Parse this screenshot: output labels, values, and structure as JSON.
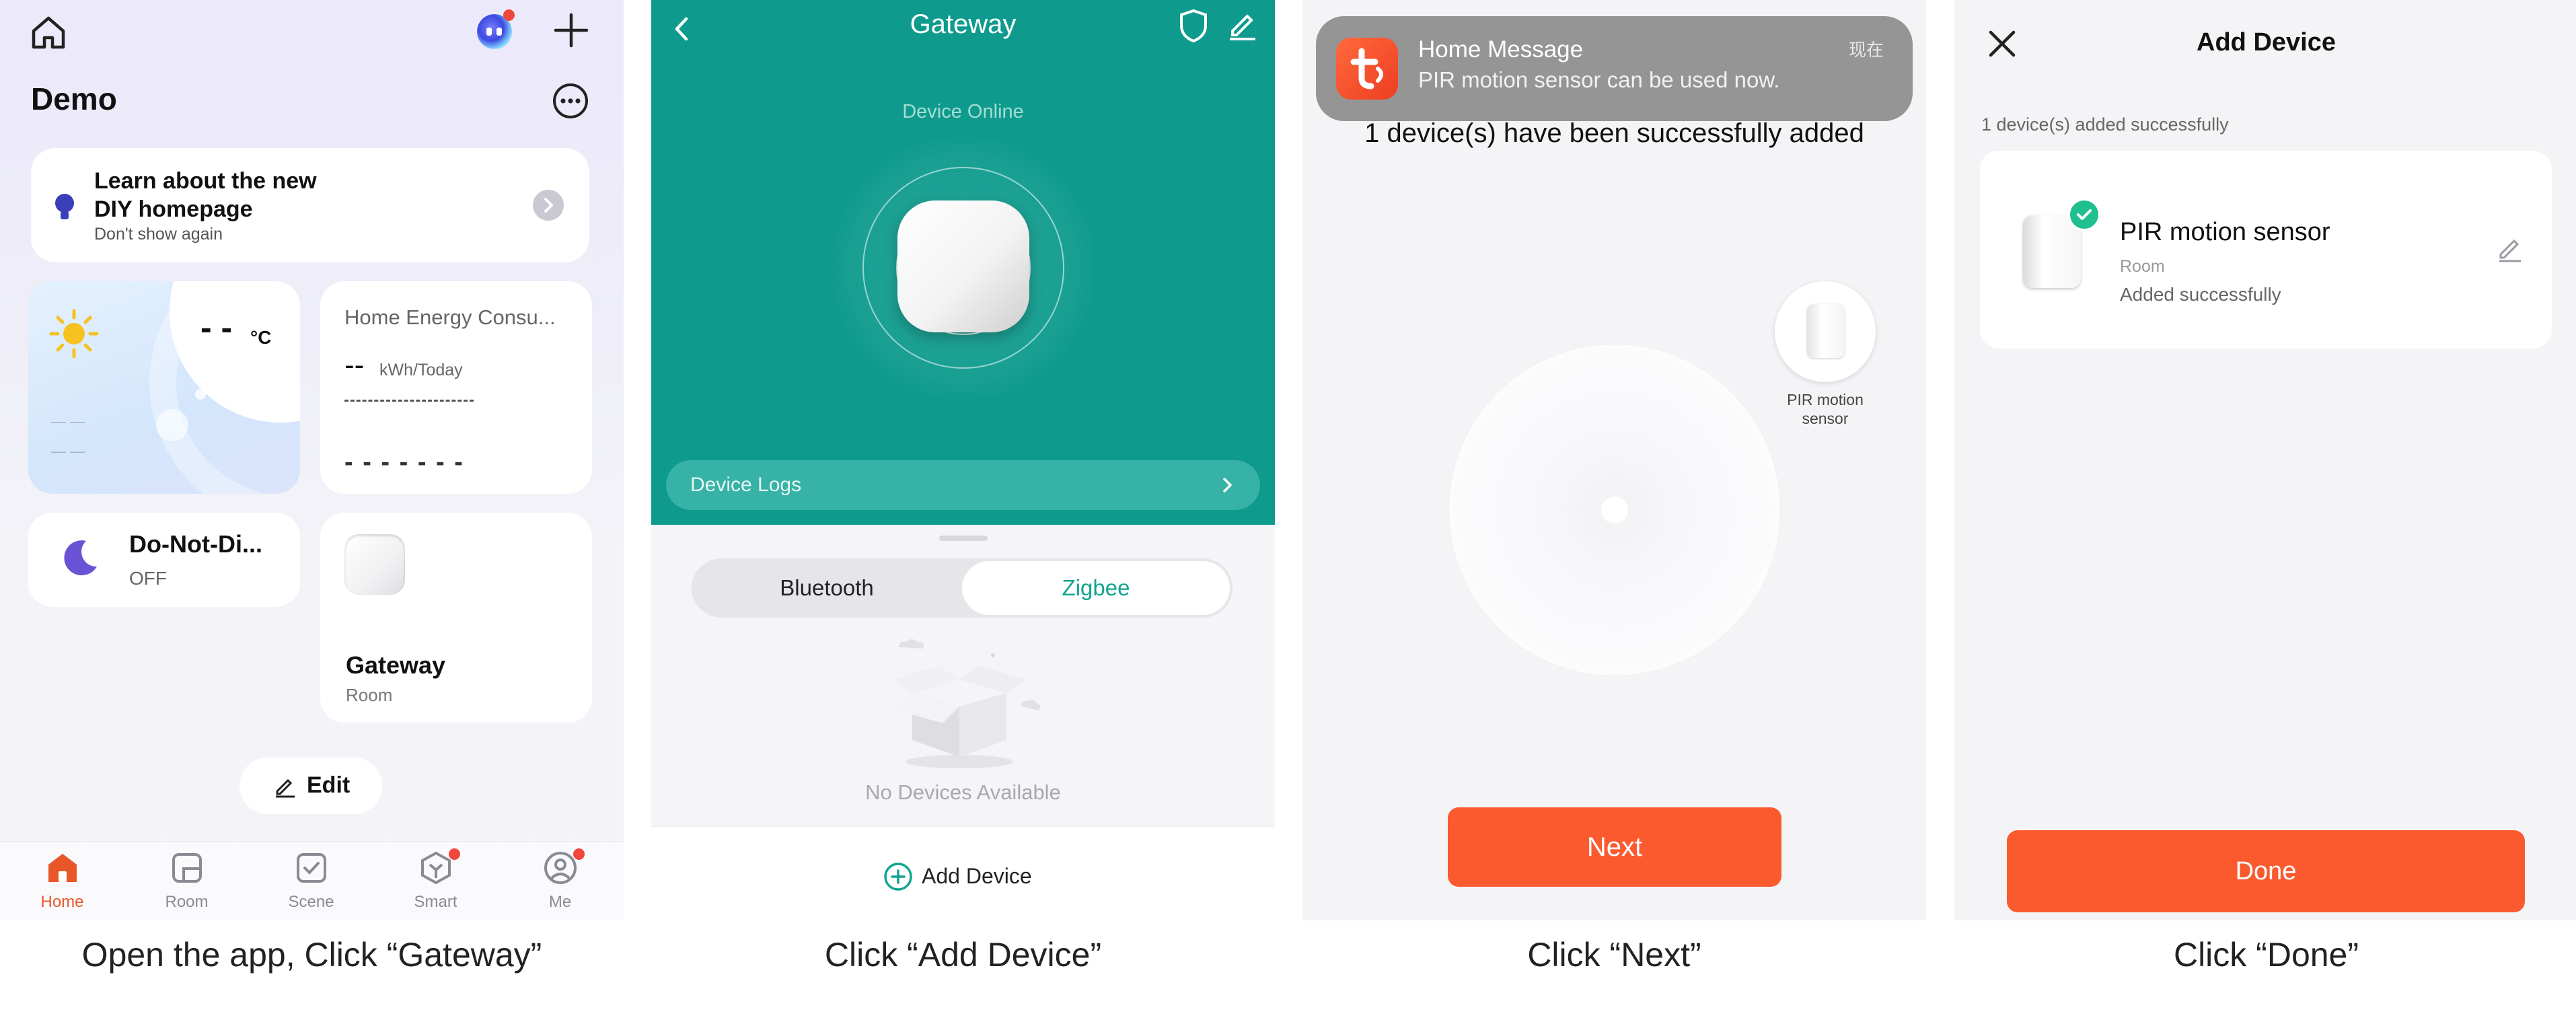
{
  "captions": [
    "Open the app, Click “Gateway”",
    "Click “Add Device”",
    "Click “Next”",
    "Click “Done”"
  ],
  "panel1": {
    "home_name": "Demo",
    "promo": {
      "title_line1": "Learn about the new",
      "title_line2": "DIY homepage",
      "subtitle": "Don't show again"
    },
    "weather": {
      "temp": "- -",
      "unit": "°C",
      "line1": "— —",
      "line2": "— —"
    },
    "energy": {
      "title": "Home Energy Consu...",
      "value": "--",
      "unit": "kWh/Today",
      "dashes": "- - - - - - -"
    },
    "dnd": {
      "title": "Do-Not-Di...",
      "status": "OFF"
    },
    "gateway": {
      "title": "Gateway",
      "room": "Room"
    },
    "edit_label": "Edit",
    "tabs": [
      {
        "label": "Home",
        "icon": "home-tab-icon"
      },
      {
        "label": "Room",
        "icon": "room-icon"
      },
      {
        "label": "Scene",
        "icon": "scene-icon"
      },
      {
        "label": "Smart",
        "icon": "smart-icon"
      },
      {
        "label": "Me",
        "icon": "me-icon"
      }
    ],
    "accent": "#e8572a"
  },
  "panel2": {
    "title": "Gateway",
    "status": "Device Online",
    "logs_label": "Device Logs",
    "seg_bluetooth": "Bluetooth",
    "seg_zigbee": "Zigbee",
    "empty_label": "No Devices Available",
    "add_device_label": "Add Device",
    "teal": "#0e9b8d"
  },
  "panel3": {
    "notification": {
      "title": "Home Message",
      "body": "PIR motion sensor can be used now.",
      "time": "现在"
    },
    "success_text": "1 device(s) have been successfully added",
    "device_label_line1": "PIR motion",
    "device_label_line2": "sensor",
    "next_label": "Next"
  },
  "panel4": {
    "title": "Add Device",
    "added_count_text": "1 device(s) added successfully",
    "device_name": "PIR motion sensor",
    "device_room": "Room",
    "device_status": "Added successfully",
    "done_label": "Done",
    "button_color": "#fb5a2f",
    "check_color": "#1fbf8f"
  }
}
